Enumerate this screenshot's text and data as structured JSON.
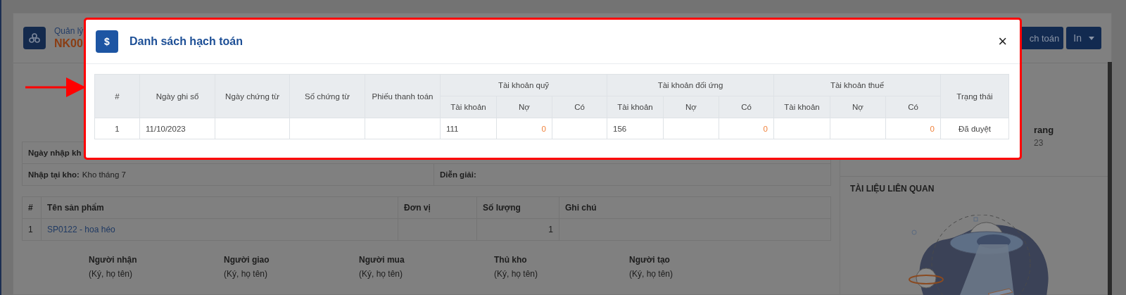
{
  "page": {
    "module": "Quản lý",
    "code": "NK00",
    "buttons": [
      {
        "label": "ch toán",
        "kind": "plain"
      },
      {
        "label": "In",
        "kind": "dropdown"
      }
    ],
    "info_label": "Ngày nhập kh",
    "warehouse_label": "Nhập tại kho:",
    "warehouse_value": "Kho tháng 7",
    "description_label": "Diễn giải:",
    "products": {
      "columns": [
        "#",
        "Tên sản phẩm",
        "Đơn vị",
        "Số lượng",
        "Ghi chú"
      ],
      "rows": [
        {
          "index": "1",
          "product": "SP0122 - hoa héo",
          "quantity": "1"
        }
      ]
    },
    "signatures": [
      {
        "role": "Người nhận",
        "hint": "(Ký, họ tên)"
      },
      {
        "role": "Người giao",
        "hint": "(Ký, họ tên)"
      },
      {
        "role": "Người mua",
        "hint": "(Ký, họ tên)"
      },
      {
        "role": "Thủ kho",
        "hint": "(Ký, họ tên)"
      },
      {
        "role": "Người tạo",
        "hint": "(Ký, họ tên)"
      }
    ],
    "side": {
      "status_fragment": "rang",
      "date_fragment": "23",
      "documents_title": "TÀI LIỆU LIÊN QUAN"
    }
  },
  "modal": {
    "icon": "$",
    "title": "Danh sách hạch toán",
    "close": "×",
    "table": {
      "leading_columns": [
        "#",
        "Ngày ghi sổ",
        "Ngày chứng từ",
        "Số chứng từ",
        "Phiếu thanh toán"
      ],
      "groups": [
        {
          "title": "Tài khoản quỹ",
          "columns": [
            "Tài khoản",
            "Nợ",
            "Có"
          ]
        },
        {
          "title": "Tài khoản đối ứng",
          "columns": [
            "Tài khoản",
            "Nợ",
            "Có"
          ]
        },
        {
          "title": "Tài khoản thuế",
          "columns": [
            "Tài khoản",
            "Nợ",
            "Có"
          ]
        }
      ],
      "trailing_columns": [
        "Trạng thái"
      ],
      "rows": [
        {
          "cells": [
            {
              "kind": "index",
              "text": "1"
            },
            {
              "kind": "text",
              "text": "11/10/2023"
            },
            {
              "kind": "text"
            },
            {
              "kind": "text"
            },
            {
              "kind": "text"
            },
            {
              "kind": "text",
              "text": "111"
            },
            {
              "kind": "amount",
              "text": "0"
            },
            {
              "kind": "amount"
            },
            {
              "kind": "text",
              "text": "156"
            },
            {
              "kind": "amount"
            },
            {
              "kind": "amount",
              "text": "0"
            },
            {
              "kind": "text"
            },
            {
              "kind": "amount"
            },
            {
              "kind": "amount",
              "text": "0"
            },
            {
              "kind": "status",
              "text": "Đã duyệt"
            }
          ]
        }
      ]
    }
  }
}
